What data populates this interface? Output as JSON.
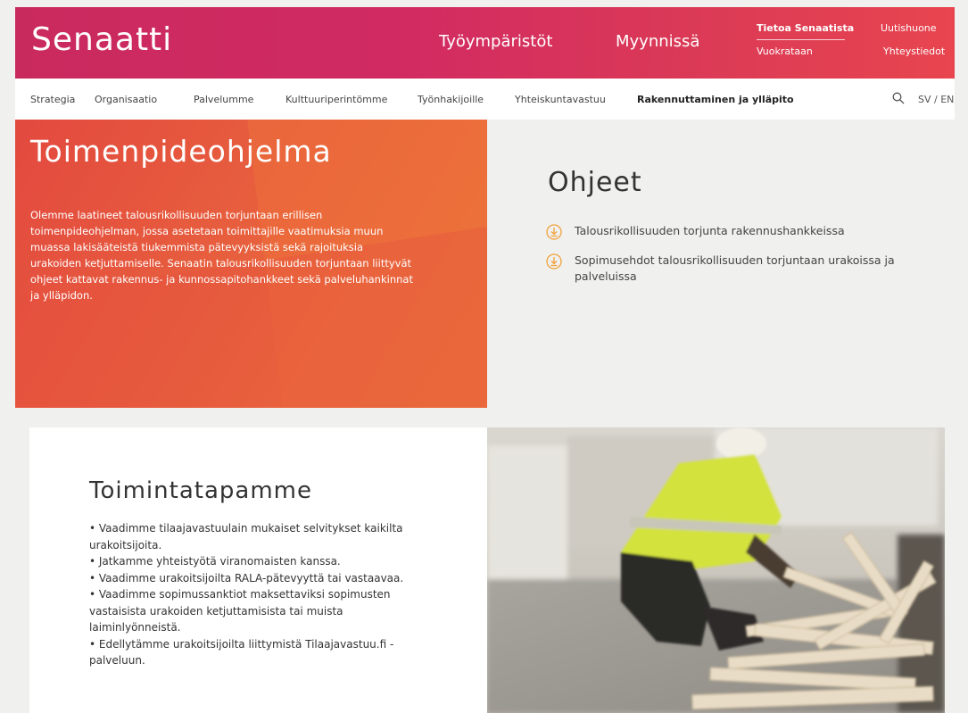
{
  "header": {
    "logo": "Senaatti",
    "main_nav": [
      "Työympäristöt",
      "Myynnissä"
    ],
    "utility": {
      "tietoa": "Tietoa Senaatista",
      "vuokrataan": "Vuokrataan",
      "uutishuone": "Uutishuone",
      "yhteystiedot": "Yhteystiedot"
    }
  },
  "subnav": {
    "items": [
      "Strategia",
      "Organisaatio",
      "Palvelumme",
      "Kulttuuriperintömme",
      "Työnhakijoille",
      "Yhteiskuntavastuu",
      "Rakennuttaminen ja ylläpito"
    ],
    "active": "Rakennuttaminen ja ylläpito",
    "lang": "SV / EN"
  },
  "hero": {
    "title": "Toimenpideohjelma",
    "body": "Olemme laatineet talousrikollisuuden torjuntaan erillisen toimenpideohjelman, jossa asetetaan toimittajille vaatimuksia muun muassa lakisääteistä tiukemmista pätevyyksistä sekä rajoituksia urakoiden ketjuttamiselle. Senaatin talousrikollisuuden torjuntaan liittyvät ohjeet kattavat rakennus- ja kunnossapitohankkeet sekä palveluhankinnat ja ylläpidon."
  },
  "ohjeet": {
    "title": "Ohjeet",
    "links": [
      "Talousrikollisuuden torjunta rakennushankkeissa",
      "Sopimusehdot talousrikollisuuden torjuntaan urakoissa ja palveluissa"
    ]
  },
  "toimintatapamme": {
    "title": "Toimintatapamme",
    "bullets": [
      "• Vaadimme tilaajavastuulain mukaiset selvitykset kaikilta urakoitsijoita.",
      "• Jatkamme yhteistyötä viranomaisten kanssa.",
      "• Vaadimme urakoitsijoilta RALA-pätevyyttä tai vastaavaa.",
      "• Vaadimme sopimussanktiot maksettaviksi sopimusten vastaisista urakoiden ketjuttamisista tai muista laiminlyönneistä.",
      "• Edellytämme urakoitsijoilta liittymistä Tilaajavastuu.fi -palveluun."
    ]
  },
  "colors": {
    "brand_pink": "#c92a5e",
    "brand_orange": "#e8633d",
    "icon_orange": "#f0a23a"
  },
  "icons": [
    "search-icon",
    "download-icon"
  ]
}
